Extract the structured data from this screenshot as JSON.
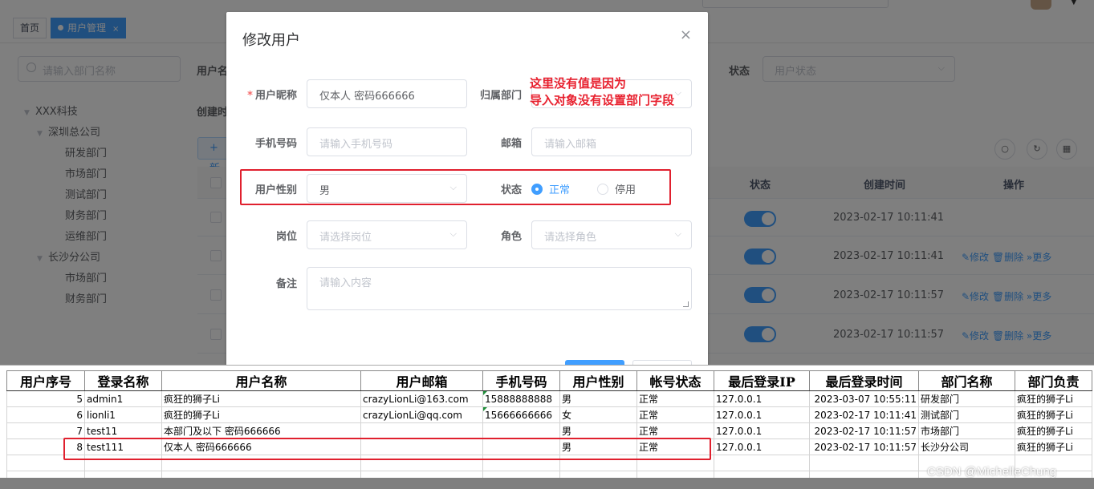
{
  "tags": {
    "home": "首页",
    "user_mgmt": "用户管理",
    "close": "×"
  },
  "tree": {
    "placeholder": "请输入部门名称",
    "nodes": [
      "XXX科技",
      "深圳总公司",
      "研发部门",
      "市场部门",
      "测试部门",
      "财务部门",
      "运维部门",
      "长沙分公司",
      "市场部门",
      "财务部门"
    ]
  },
  "filters": {
    "username_label": "用户名",
    "status_label": "状态",
    "status_placeholder": "用户状态",
    "created_label": "创建时"
  },
  "toolbar": {
    "add": "+ 新"
  },
  "table": {
    "headers": {
      "status": "状态",
      "created": "创建时间",
      "ops": "操作"
    },
    "rows": [
      {
        "time": "2023-02-17 10:11:41",
        "ops": ""
      },
      {
        "time": "2023-02-17 10:11:41",
        "ops": "✎修改  🗑删除  »更多"
      },
      {
        "time": "2023-02-17 10:11:57",
        "ops": "✎修改  🗑删除  »更多"
      },
      {
        "time": "2023-02-17 10:11:57",
        "ops": "✎修改  🗑删除  »更多"
      }
    ]
  },
  "dialog": {
    "title": "修改用户",
    "close": "×",
    "nickname_label": "用户昵称",
    "nickname_value": "仅本人 密码666666",
    "dept_label": "归属部门",
    "phone_label": "手机号码",
    "phone_placeholder": "请输入手机号码",
    "email_label": "邮箱",
    "email_placeholder": "请输入邮箱",
    "gender_label": "用户性别",
    "gender_value": "男",
    "status_label": "状态",
    "status_normal": "正常",
    "status_disabled": "停用",
    "post_label": "岗位",
    "post_placeholder": "请选择岗位",
    "role_label": "角色",
    "role_placeholder": "请选择角色",
    "remark_label": "备注",
    "remark_placeholder": "请输入内容",
    "annotation_line1": "这里没有值是因为",
    "annotation_line2": "导入对象没有设置部门字段"
  },
  "sheet": {
    "headers": [
      "用户序号",
      "登录名称",
      "用户名称",
      "用户邮箱",
      "手机号码",
      "用户性别",
      "帐号状态",
      "最后登录IP",
      "最后登录时间",
      "部门名称",
      "部门负责"
    ],
    "rows": [
      [
        "5",
        "admin1",
        "疯狂的狮子Li",
        "crazyLionLi@163.com",
        "15888888888",
        "男",
        "正常",
        "127.0.0.1",
        "2023-03-07 10:55:11",
        "研发部门",
        "疯狂的狮子Li"
      ],
      [
        "6",
        "lionli1",
        "疯狂的狮子Li",
        "crazyLionLi@qq.com",
        "15666666666",
        "女",
        "正常",
        "127.0.0.1",
        "2023-02-17 10:11:41",
        "测试部门",
        "疯狂的狮子Li"
      ],
      [
        "7",
        "test11",
        "本部门及以下 密码666666",
        "",
        "",
        "男",
        "正常",
        "127.0.0.1",
        "2023-02-17 10:11:57",
        "市场部门",
        "疯狂的狮子Li"
      ],
      [
        "8",
        "test111",
        "仅本人 密码666666",
        "",
        "",
        "男",
        "正常",
        "127.0.0.1",
        "2023-02-17 10:11:57",
        "长沙分公司",
        "疯狂的狮子Li"
      ]
    ]
  },
  "watermark": "CSDN @MichelleChung",
  "colors": {
    "primary": "#409eff",
    "annotation_red": "#e8212f"
  }
}
